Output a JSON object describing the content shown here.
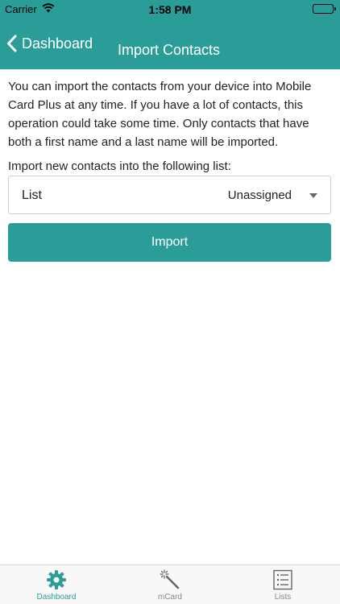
{
  "status_bar": {
    "carrier": "Carrier",
    "time": "1:58 PM"
  },
  "nav": {
    "back_label": "Dashboard",
    "title": "Import Contacts"
  },
  "content": {
    "description": "You can import the contacts from your device into Mobile Card Plus at any time. If you have a lot of contacts, this operation could take some time. Only contacts that have both a first name and a last name will be imported.",
    "list_caption": "Import new contacts into the following list:",
    "list_picker": {
      "label": "List",
      "selected_value": "Unassigned"
    },
    "import_button": "Import"
  },
  "tabs": [
    {
      "label": "Dashboard",
      "icon": "gear-icon",
      "active": true
    },
    {
      "label": "mCard",
      "icon": "magic-wand-icon",
      "active": false
    },
    {
      "label": "Lists",
      "icon": "list-icon",
      "active": false
    }
  ],
  "colors": {
    "accent": "#2a9d99",
    "tab_inactive": "#888888"
  }
}
